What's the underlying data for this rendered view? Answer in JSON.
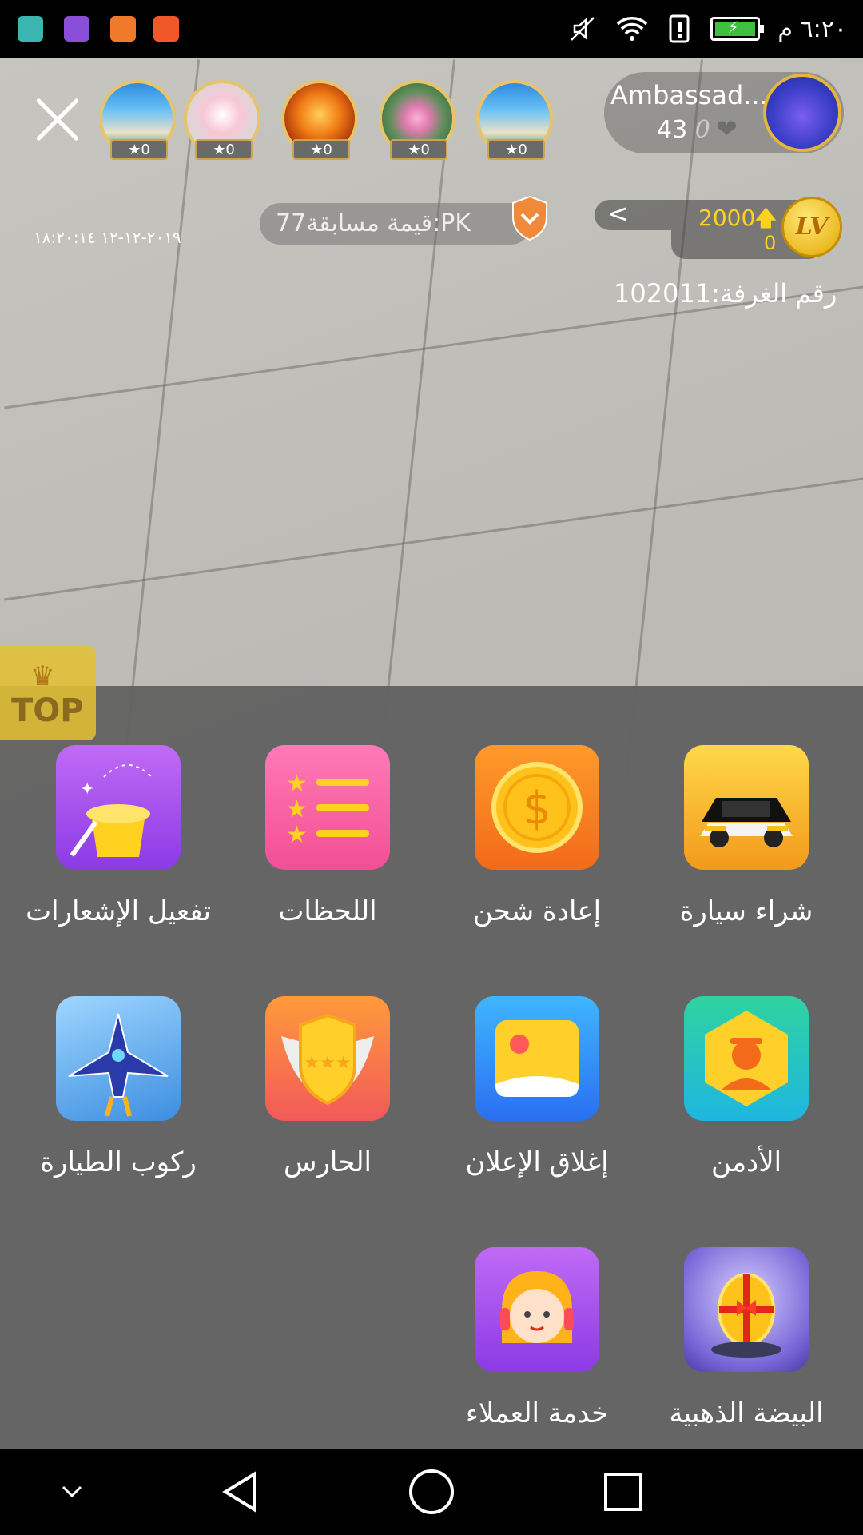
{
  "status_bar": {
    "time": "٦:٢٠ م",
    "app_icons": [
      "android-icon",
      "gallery-icon",
      "music-icon",
      "music-icon"
    ],
    "app_colors": [
      "#3bb5b0",
      "#8a4fd8",
      "#f07a2a",
      "#f0582a"
    ]
  },
  "header": {
    "viewers": [
      {
        "badge": "0",
        "icon": "beach-avatar"
      },
      {
        "badge": "0",
        "icon": "flowers-avatar"
      },
      {
        "badge": "0",
        "icon": "autumn-leaves-avatar"
      },
      {
        "badge": "0",
        "icon": "lotus-avatar"
      },
      {
        "badge": "0",
        "icon": "beach-avatar"
      }
    ],
    "host_name": "Ambassad...",
    "host_count": "43",
    "host_likes": "0",
    "pk_label": "قيمة مسابقة77:PK",
    "datetime": "٢٠١٩-١٢-١٢ ١٨:٢٠:١٤",
    "coins": "2000",
    "coins_sub": "0",
    "level_badge": "LV",
    "room_number": "رقم الغرفة:102011",
    "top_label": "TOP"
  },
  "menu": {
    "items": [
      {
        "label": "شراء سيارة",
        "icon": "sports-car-icon"
      },
      {
        "label": "إعادة شحن",
        "icon": "coin-dollar-icon"
      },
      {
        "label": "اللحظات",
        "icon": "star-list-icon"
      },
      {
        "label": "تفعيل الإشعارات",
        "icon": "magic-hat-icon"
      },
      {
        "label": "الأدمن",
        "icon": "admin-person-icon"
      },
      {
        "label": "إغلاق الإعلان",
        "icon": "image-ad-icon"
      },
      {
        "label": "الحارس",
        "icon": "guard-shield-icon"
      },
      {
        "label": "ركوب الطيارة",
        "icon": "fighter-jet-icon"
      },
      {
        "label": "البيضة الذهبية",
        "icon": "golden-egg-icon"
      },
      {
        "label": "خدمة العملاء",
        "icon": "customer-service-icon"
      }
    ]
  },
  "nav": {
    "icons": [
      "chevron-down-icon",
      "back-icon",
      "home-icon",
      "recents-icon"
    ]
  }
}
